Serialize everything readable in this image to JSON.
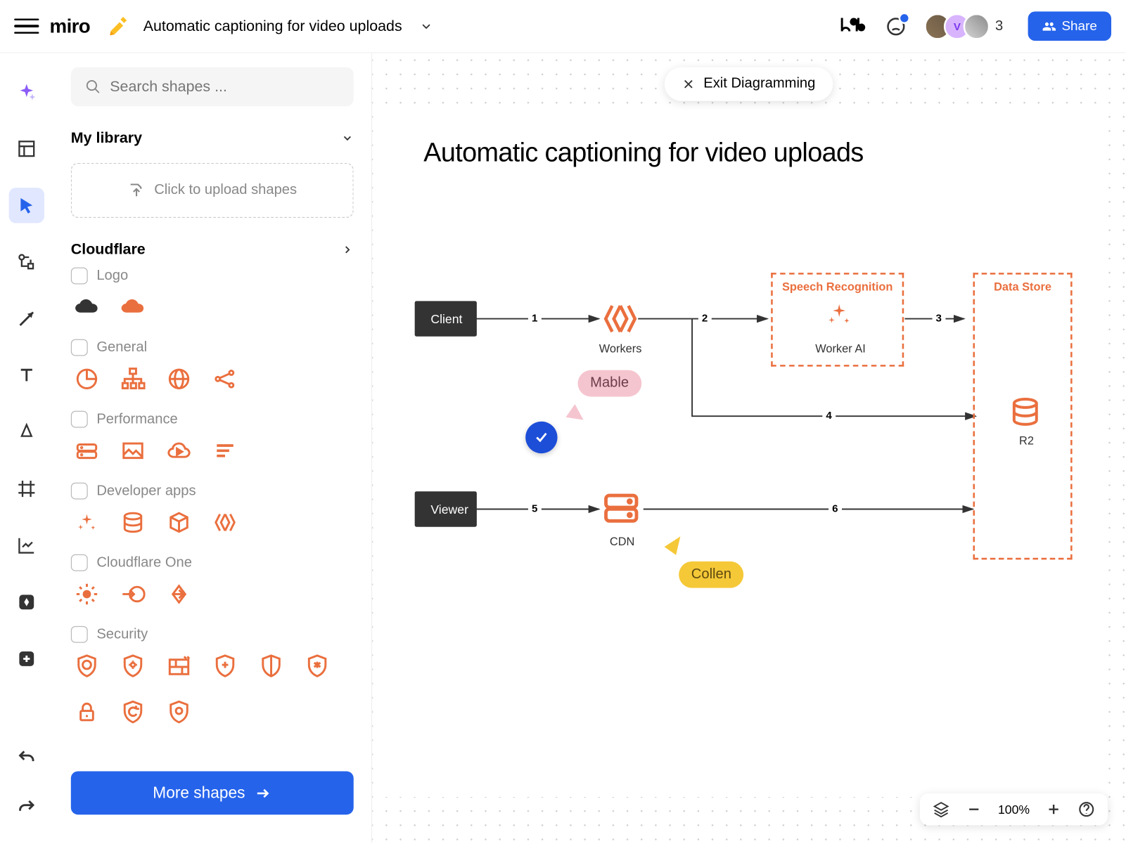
{
  "app": {
    "name": "miro"
  },
  "board": {
    "title": "Automatic captioning for video uploads"
  },
  "topbar": {
    "collab_count": "3",
    "share_label": "Share"
  },
  "exit_pill": "Exit Diagramming",
  "shapes_panel": {
    "search_placeholder": "Search shapes ...",
    "my_library_label": "My library",
    "upload_label": "Click to upload shapes",
    "cloudflare_label": "Cloudflare",
    "more_shapes_label": "More shapes",
    "groups": {
      "logo": "Logo",
      "general": "General",
      "performance": "Performance",
      "developer_apps": "Developer apps",
      "cloudflare_one": "Cloudflare One",
      "security": "Security"
    }
  },
  "diagram": {
    "title": "Automatic captioning for video uploads",
    "nodes": {
      "client": "Client",
      "viewer": "Viewer",
      "workers": "Workers",
      "worker_ai": "Worker AI",
      "cdn": "CDN",
      "r2": "R2"
    },
    "groups": {
      "speech_recognition": "Speech Recognition",
      "data_store": "Data Store"
    },
    "edges": {
      "e1": "1",
      "e2": "2",
      "e3": "3",
      "e4": "4",
      "e5": "5",
      "e6": "6"
    },
    "cursors": {
      "mable": "Mable",
      "collen": "Collen"
    }
  },
  "zoom": {
    "level": "100%"
  }
}
